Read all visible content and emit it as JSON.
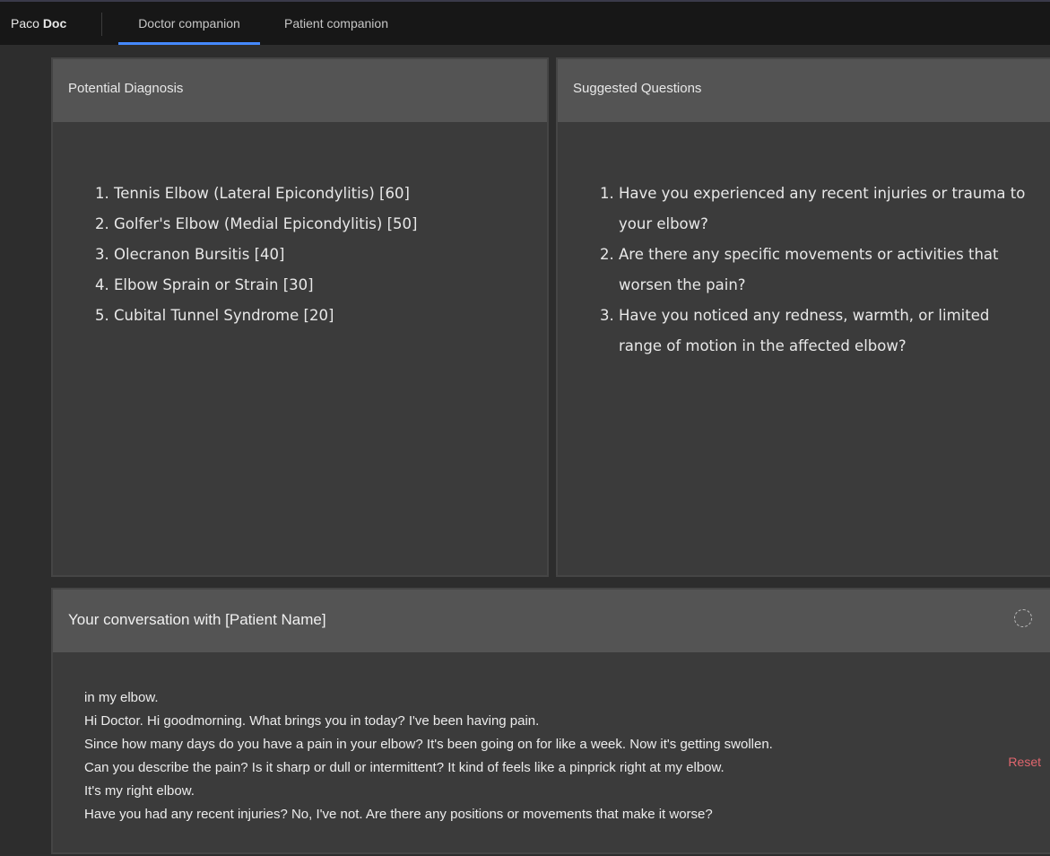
{
  "app": {
    "brand_light": "Paco ",
    "brand_bold": "Doc"
  },
  "nav": {
    "tabs": [
      {
        "label": "Doctor companion",
        "active": true
      },
      {
        "label": "Patient companion",
        "active": false
      }
    ]
  },
  "diagnosis": {
    "title": "Potential Diagnosis",
    "items": [
      "Tennis Elbow (Lateral Epicondylitis) [60]",
      "Golfer's Elbow (Medial Epicondylitis) [50]",
      "Olecranon Bursitis [40]",
      "Elbow Sprain or Strain [30]",
      "Cubital Tunnel Syndrome [20]"
    ]
  },
  "questions": {
    "title": "Suggested Questions",
    "items": [
      "Have you experienced any recent injuries or trauma to your elbow?",
      "Are there any specific movements or activities that worsen the pain?",
      "Have you noticed any redness, warmth, or limited range of motion in the affected elbow?"
    ]
  },
  "conversation": {
    "title": "Your conversation with [Patient Name]",
    "lines": [
      "in my elbow.",
      "Hi Doctor. Hi goodmorning. What brings you in today? I've been having pain.",
      "Since how many days do you have a pain in your elbow? It's been going on for like a week. Now it's getting swollen.",
      "Can you describe the pain? Is it sharp or dull or intermittent? It kind of feels like a pinprick right at my elbow.",
      "It's my right elbow.",
      "Have you had any recent injuries? No, I've not. Are there any positions or movements that make it worse?"
    ],
    "reset_label": "Reset",
    "status_icon": "loading-spinner-icon"
  },
  "colors": {
    "tab_active_indicator": "#4589ff",
    "reset": "#e0666e"
  }
}
